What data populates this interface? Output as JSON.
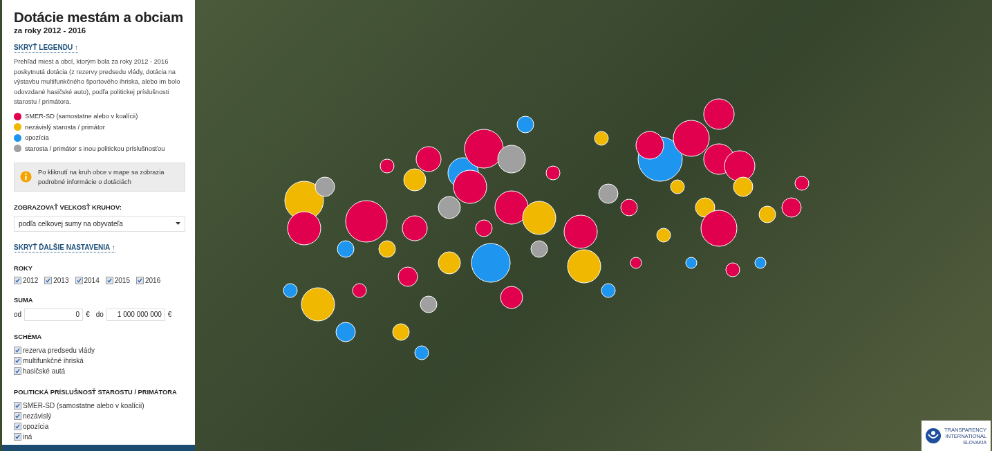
{
  "title": "Dotácie mestám a obciam",
  "subtitle": "za roky 2012 - 2016",
  "legend_toggle": "SKRYŤ LEGENDU ↑",
  "description": "Prehľad miest a obcí, ktorým bola za roky 2012 - 2016 poskytnutá dotácia (z rezervy predsedu vlády, dotácia na výstavbu multifunkčného športového ihriska, alebo im bolo odovzdané hasičské auto), podľa politickej príslušnosti starostu / primátora.",
  "legend": [
    {
      "label": "SMER-SD (samostatne alebo v koalícii)",
      "color": "#e0004d"
    },
    {
      "label": "nezávislý starosta / primátor",
      "color": "#f0b800"
    },
    {
      "label": "opozícia",
      "color": "#1e96f0"
    },
    {
      "label": "starosta / primátor s inou politickou príslušnosťou",
      "color": "#a0a0a0"
    }
  ],
  "info": "Po kliknutí na kruh obce v mape sa zobrazia podrobné informácie o dotáciách",
  "size_label": "ZOBRAZOVAŤ VEĽKOSŤ KRUHOV:",
  "size_select": {
    "value": "podľa celkovej sumy na obyvateľa"
  },
  "settings_toggle": "SKRYŤ ĎALŠIE NASTAVENIA ↑",
  "years": {
    "heading": "ROKY",
    "items": [
      {
        "label": "2012",
        "checked": true
      },
      {
        "label": "2013",
        "checked": true
      },
      {
        "label": "2014",
        "checked": true
      },
      {
        "label": "2015",
        "checked": true
      },
      {
        "label": "2016",
        "checked": true
      }
    ]
  },
  "sum": {
    "heading": "SUMA",
    "from_label": "od",
    "from_value": "0",
    "from_unit": "€",
    "to_label": "do",
    "to_value": "1 000 000 000",
    "to_unit": "€"
  },
  "scheme": {
    "heading": "SCHÉMA",
    "items": [
      {
        "label": "rezerva predsedu vlády",
        "checked": true
      },
      {
        "label": "multifunkčné ihriská",
        "checked": true
      },
      {
        "label": "hasičské autá",
        "checked": true
      }
    ]
  },
  "affiliation": {
    "heading": "POLITICKÁ PRÍSLUŠNOSŤ STAROSTU / PRIMÁTORA",
    "items": [
      {
        "label": "SMER-SD (samostatne alebo v koalícii)",
        "checked": true
      },
      {
        "label": "nezávislý",
        "checked": true
      },
      {
        "label": "opozícia",
        "checked": true
      },
      {
        "label": "iná",
        "checked": true
      }
    ]
  },
  "logo": {
    "lines": [
      "TRANSPARENCY",
      "INTERNATIONAL",
      "SLOVAKIA"
    ]
  }
}
